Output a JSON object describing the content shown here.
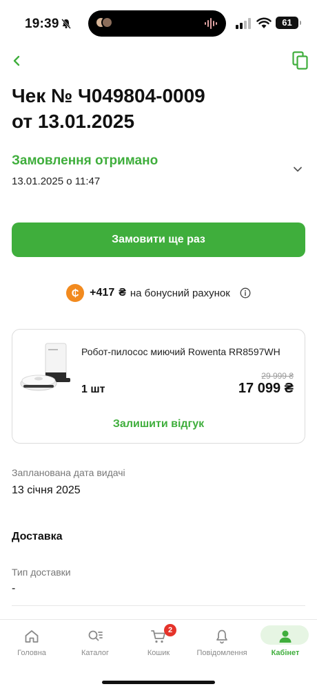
{
  "status_bar": {
    "time": "19:39",
    "battery": "61"
  },
  "header": {
    "title_line1": "Чек № Ч049804-0009",
    "title_line2": "от 13.01.2025"
  },
  "order_status": {
    "text": "Замовлення отримано",
    "date": "13.01.2025 о 11:47"
  },
  "reorder_button": "Замовити ще раз",
  "bonus": {
    "coin_symbol": "₵",
    "amount": "+417",
    "currency": "₴",
    "text": "на бонусний рахунок"
  },
  "product": {
    "name": "Робот-пилосос миючий Rowenta RR8597WH",
    "quantity": "1 шт",
    "old_price": "29 999 ₴",
    "price": "17 099 ₴",
    "review_button": "Залишити відгук"
  },
  "planned_date": {
    "label": "Запланована дата видачі",
    "value": "13 січня 2025"
  },
  "delivery": {
    "title": "Доставка",
    "type_label": "Тип доставки",
    "type_value": "-"
  },
  "bottom_nav": {
    "items": [
      {
        "label": "Головна",
        "icon": "home-icon"
      },
      {
        "label": "Каталог",
        "icon": "catalog-icon"
      },
      {
        "label": "Кошик",
        "icon": "cart-icon",
        "badge": "2"
      },
      {
        "label": "Повідомлення",
        "icon": "bell-icon"
      },
      {
        "label": "Кабінет",
        "icon": "user-icon",
        "active": true
      }
    ]
  },
  "colors": {
    "accent_green": "#3fae3c",
    "bonus_orange": "#f28a1e",
    "badge_red": "#e5332a"
  }
}
